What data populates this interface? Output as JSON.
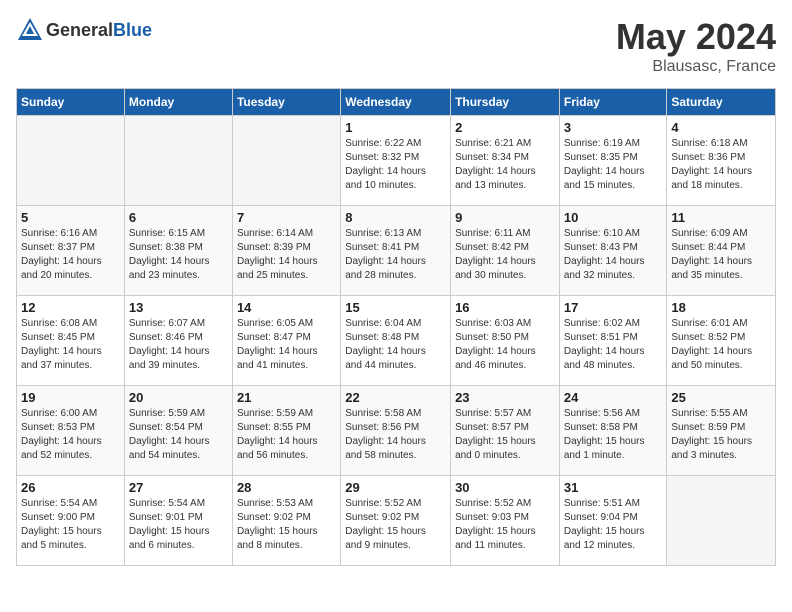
{
  "header": {
    "logo_general": "General",
    "logo_blue": "Blue",
    "month": "May 2024",
    "location": "Blausasc, France"
  },
  "weekdays": [
    "Sunday",
    "Monday",
    "Tuesday",
    "Wednesday",
    "Thursday",
    "Friday",
    "Saturday"
  ],
  "weeks": [
    [
      {
        "day": "",
        "info": ""
      },
      {
        "day": "",
        "info": ""
      },
      {
        "day": "",
        "info": ""
      },
      {
        "day": "1",
        "info": "Sunrise: 6:22 AM\nSunset: 8:32 PM\nDaylight: 14 hours\nand 10 minutes."
      },
      {
        "day": "2",
        "info": "Sunrise: 6:21 AM\nSunset: 8:34 PM\nDaylight: 14 hours\nand 13 minutes."
      },
      {
        "day": "3",
        "info": "Sunrise: 6:19 AM\nSunset: 8:35 PM\nDaylight: 14 hours\nand 15 minutes."
      },
      {
        "day": "4",
        "info": "Sunrise: 6:18 AM\nSunset: 8:36 PM\nDaylight: 14 hours\nand 18 minutes."
      }
    ],
    [
      {
        "day": "5",
        "info": "Sunrise: 6:16 AM\nSunset: 8:37 PM\nDaylight: 14 hours\nand 20 minutes."
      },
      {
        "day": "6",
        "info": "Sunrise: 6:15 AM\nSunset: 8:38 PM\nDaylight: 14 hours\nand 23 minutes."
      },
      {
        "day": "7",
        "info": "Sunrise: 6:14 AM\nSunset: 8:39 PM\nDaylight: 14 hours\nand 25 minutes."
      },
      {
        "day": "8",
        "info": "Sunrise: 6:13 AM\nSunset: 8:41 PM\nDaylight: 14 hours\nand 28 minutes."
      },
      {
        "day": "9",
        "info": "Sunrise: 6:11 AM\nSunset: 8:42 PM\nDaylight: 14 hours\nand 30 minutes."
      },
      {
        "day": "10",
        "info": "Sunrise: 6:10 AM\nSunset: 8:43 PM\nDaylight: 14 hours\nand 32 minutes."
      },
      {
        "day": "11",
        "info": "Sunrise: 6:09 AM\nSunset: 8:44 PM\nDaylight: 14 hours\nand 35 minutes."
      }
    ],
    [
      {
        "day": "12",
        "info": "Sunrise: 6:08 AM\nSunset: 8:45 PM\nDaylight: 14 hours\nand 37 minutes."
      },
      {
        "day": "13",
        "info": "Sunrise: 6:07 AM\nSunset: 8:46 PM\nDaylight: 14 hours\nand 39 minutes."
      },
      {
        "day": "14",
        "info": "Sunrise: 6:05 AM\nSunset: 8:47 PM\nDaylight: 14 hours\nand 41 minutes."
      },
      {
        "day": "15",
        "info": "Sunrise: 6:04 AM\nSunset: 8:48 PM\nDaylight: 14 hours\nand 44 minutes."
      },
      {
        "day": "16",
        "info": "Sunrise: 6:03 AM\nSunset: 8:50 PM\nDaylight: 14 hours\nand 46 minutes."
      },
      {
        "day": "17",
        "info": "Sunrise: 6:02 AM\nSunset: 8:51 PM\nDaylight: 14 hours\nand 48 minutes."
      },
      {
        "day": "18",
        "info": "Sunrise: 6:01 AM\nSunset: 8:52 PM\nDaylight: 14 hours\nand 50 minutes."
      }
    ],
    [
      {
        "day": "19",
        "info": "Sunrise: 6:00 AM\nSunset: 8:53 PM\nDaylight: 14 hours\nand 52 minutes."
      },
      {
        "day": "20",
        "info": "Sunrise: 5:59 AM\nSunset: 8:54 PM\nDaylight: 14 hours\nand 54 minutes."
      },
      {
        "day": "21",
        "info": "Sunrise: 5:59 AM\nSunset: 8:55 PM\nDaylight: 14 hours\nand 56 minutes."
      },
      {
        "day": "22",
        "info": "Sunrise: 5:58 AM\nSunset: 8:56 PM\nDaylight: 14 hours\nand 58 minutes."
      },
      {
        "day": "23",
        "info": "Sunrise: 5:57 AM\nSunset: 8:57 PM\nDaylight: 15 hours\nand 0 minutes."
      },
      {
        "day": "24",
        "info": "Sunrise: 5:56 AM\nSunset: 8:58 PM\nDaylight: 15 hours\nand 1 minute."
      },
      {
        "day": "25",
        "info": "Sunrise: 5:55 AM\nSunset: 8:59 PM\nDaylight: 15 hours\nand 3 minutes."
      }
    ],
    [
      {
        "day": "26",
        "info": "Sunrise: 5:54 AM\nSunset: 9:00 PM\nDaylight: 15 hours\nand 5 minutes."
      },
      {
        "day": "27",
        "info": "Sunrise: 5:54 AM\nSunset: 9:01 PM\nDaylight: 15 hours\nand 6 minutes."
      },
      {
        "day": "28",
        "info": "Sunrise: 5:53 AM\nSunset: 9:02 PM\nDaylight: 15 hours\nand 8 minutes."
      },
      {
        "day": "29",
        "info": "Sunrise: 5:52 AM\nSunset: 9:02 PM\nDaylight: 15 hours\nand 9 minutes."
      },
      {
        "day": "30",
        "info": "Sunrise: 5:52 AM\nSunset: 9:03 PM\nDaylight: 15 hours\nand 11 minutes."
      },
      {
        "day": "31",
        "info": "Sunrise: 5:51 AM\nSunset: 9:04 PM\nDaylight: 15 hours\nand 12 minutes."
      },
      {
        "day": "",
        "info": ""
      }
    ]
  ]
}
